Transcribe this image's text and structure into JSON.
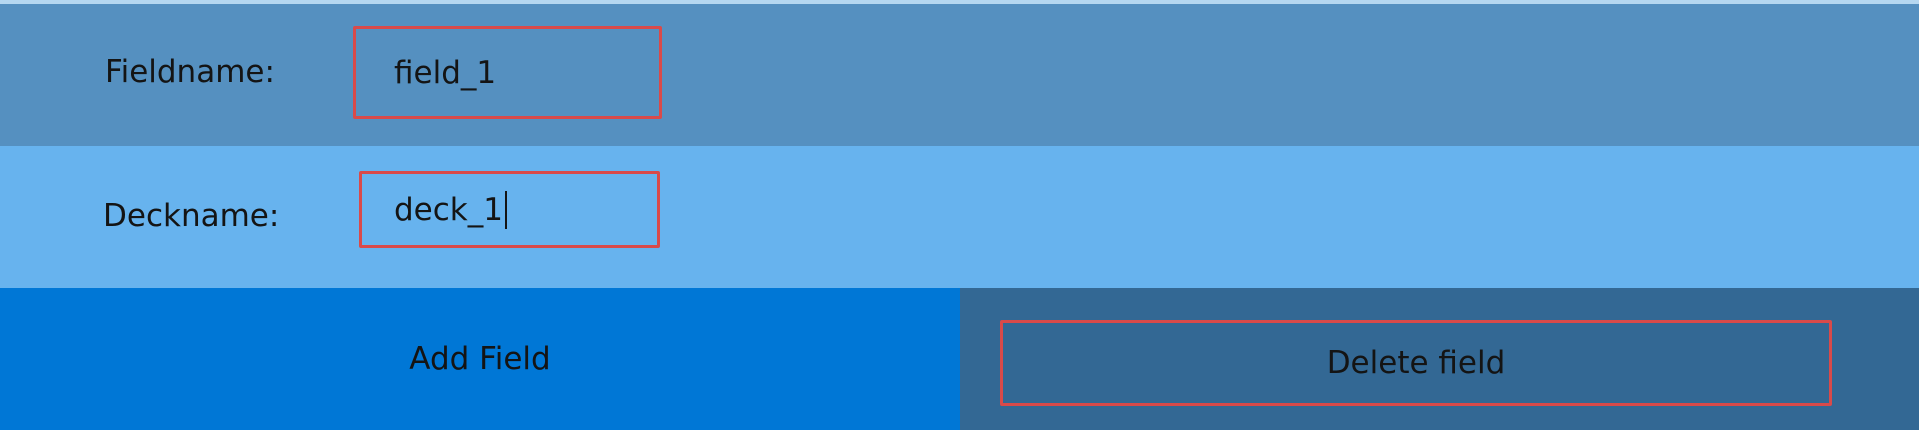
{
  "form": {
    "fieldname_label": "Fieldname:",
    "fieldname_value": "field_1",
    "deckname_label": "Deckname:",
    "deckname_value": "deck_1"
  },
  "buttons": {
    "add_label": "Add Field",
    "delete_label": "Delete field"
  },
  "colors": {
    "row_fieldname_bg": "#5590c0",
    "row_deckname_bg": "#67b3ee",
    "add_button_bg": "#0077d6",
    "delete_area_bg": "#336894",
    "focus_border": "#d94a4a"
  }
}
